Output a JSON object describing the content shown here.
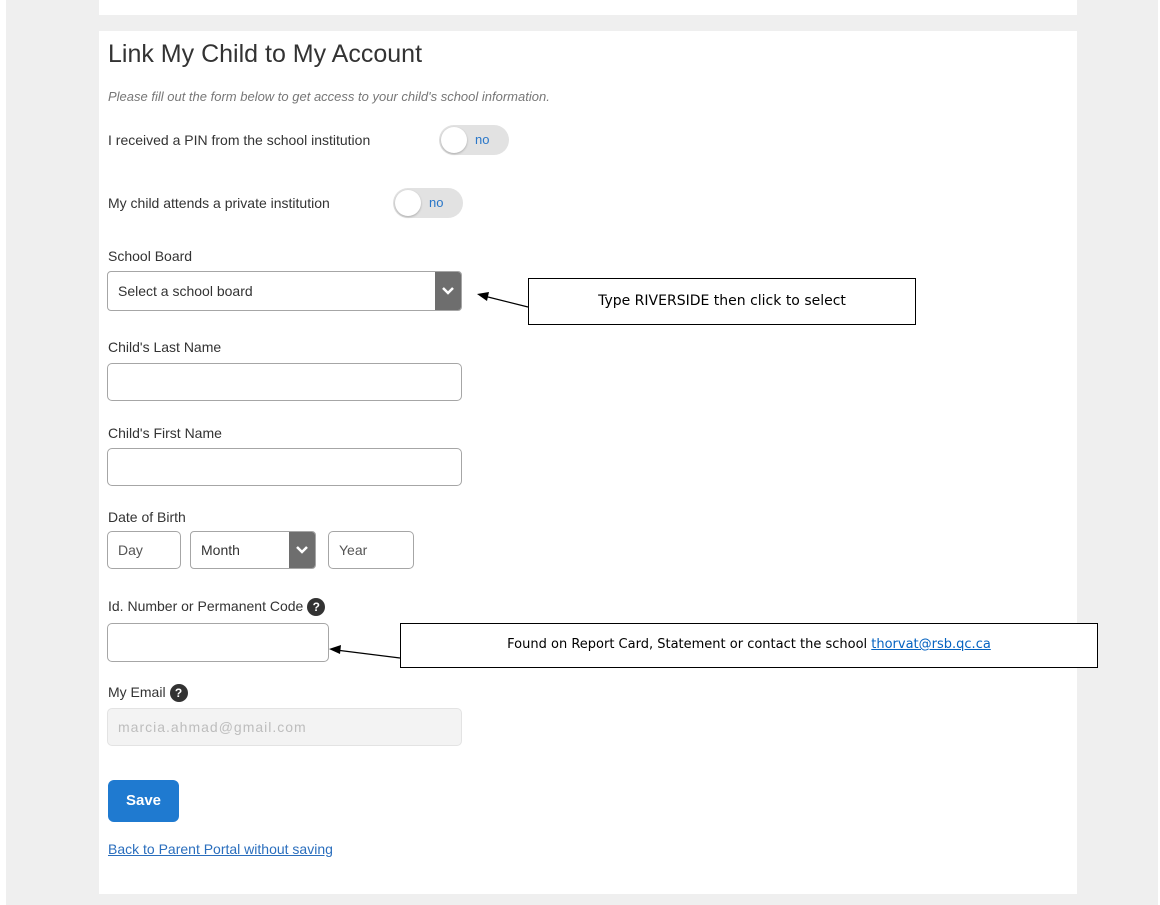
{
  "form": {
    "title": "Link My Child to My Account",
    "subtitle": "Please fill out the form below to get access to your child's school information.",
    "pin_label": "I received a PIN from the school institution",
    "pin_toggle": "no",
    "private_label": "My child attends a private institution",
    "private_toggle": "no",
    "board_label": "School Board",
    "board_select": "Select a school board",
    "last_name_label": "Child's Last Name",
    "first_name_label": "Child's First Name",
    "dob_label": "Date of Birth",
    "dob_day": "Day",
    "dob_month": "Month",
    "dob_year": "Year",
    "id_label": "Id. Number or Permanent Code",
    "email_label": "My Email",
    "email_value": "marcia.ahmad@gmail.com",
    "help_glyph": "?",
    "save_label": "Save",
    "back_link": "Back to Parent Portal without saving"
  },
  "annotations": {
    "board_callout": "Type RIVERSIDE then click to select",
    "id_callout_text": "Found on Report Card, Statement or contact the school ",
    "id_callout_email": "thorvat@rsb.qc.ca"
  },
  "colors": {
    "primary": "#1f7ad0",
    "link": "#2a6ebd",
    "toggle_text": "#2a77c9"
  }
}
